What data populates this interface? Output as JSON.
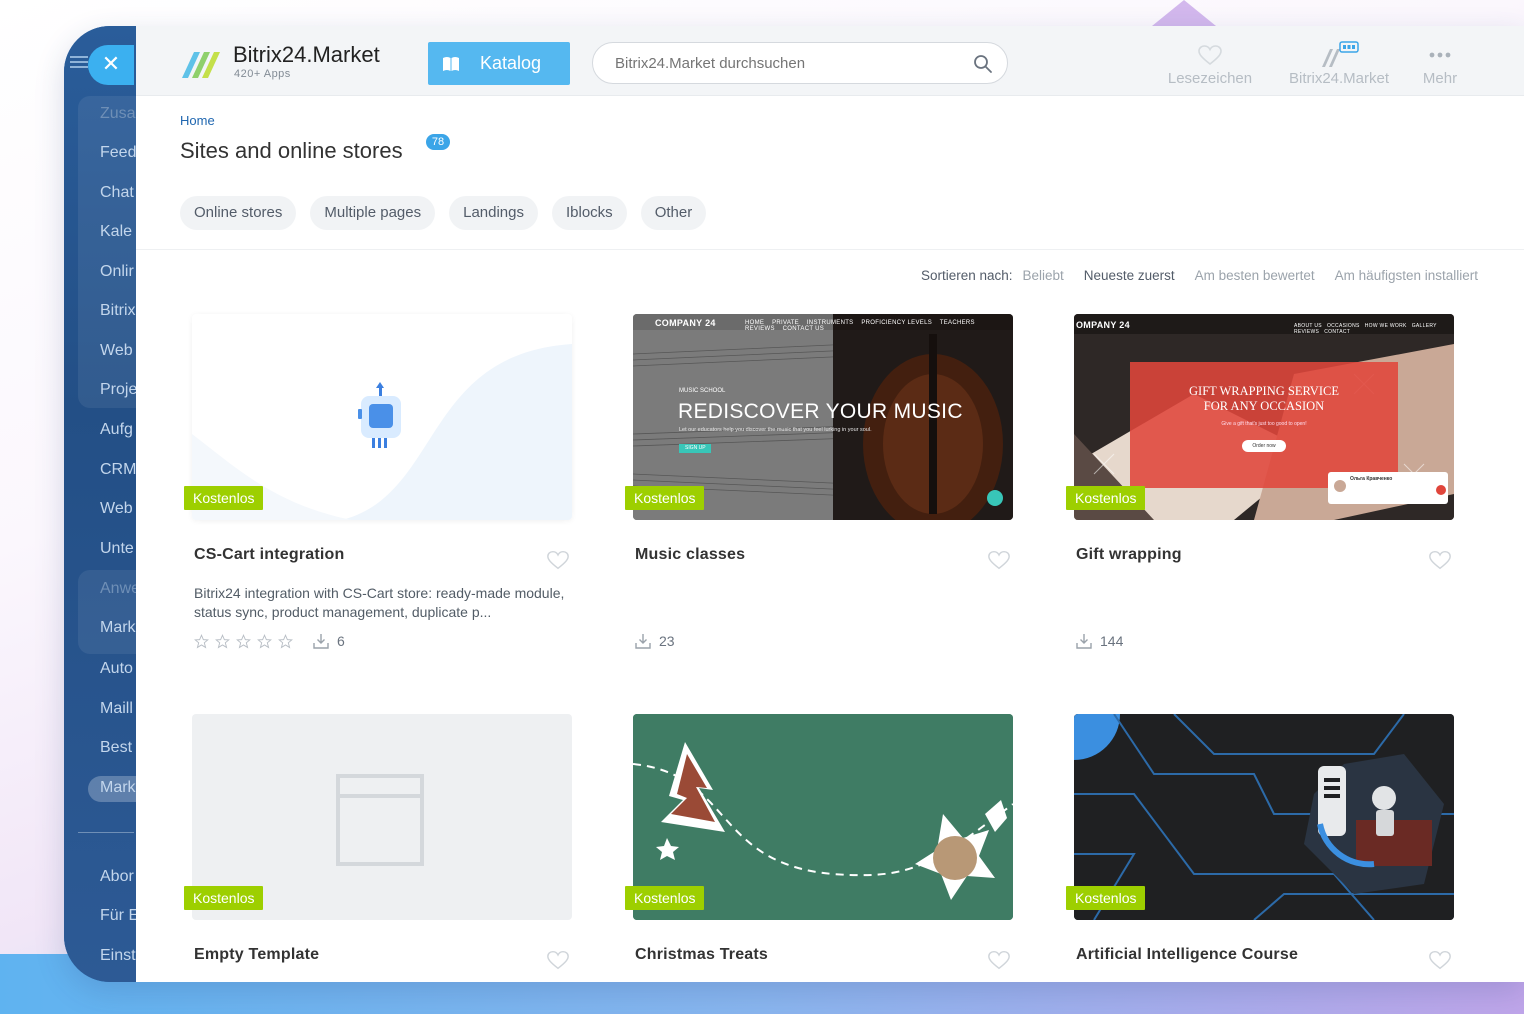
{
  "sidebar": {
    "items": [
      "Zusa",
      "Feed",
      "Chat",
      "Kale",
      "Onlir",
      "Bitrix",
      "Web",
      "Proje",
      "Aufg",
      "CRM",
      "Web",
      "Unte",
      "Anwe",
      "Mark",
      "Auto",
      "Maill",
      "Best",
      "Mark",
      "Abor",
      "Für E",
      "Einst"
    ]
  },
  "header": {
    "logo_title": "Bitrix24.Market",
    "logo_subtitle": "420+ Apps",
    "katalog_label": "Katalog",
    "search_placeholder": "Bitrix24.Market durchsuchen",
    "nav": [
      {
        "label": "Lesezeichen",
        "icon": "heart-icon"
      },
      {
        "label": "Bitrix24.Market",
        "icon": "market-icon"
      },
      {
        "label": "Mehr",
        "icon": "more-dots-icon"
      }
    ]
  },
  "breadcrumb": "Home",
  "page_title": "Sites and online stores",
  "count": "78",
  "filters": [
    "Online stores",
    "Multiple pages",
    "Landings",
    "Iblocks",
    "Other"
  ],
  "sort": {
    "label": "Sortieren nach:",
    "options": [
      "Beliebt",
      "Neueste zuerst",
      "Am besten bewertet",
      "Am häufigsten installiert"
    ]
  },
  "cards": [
    {
      "title": "CS-Cart integration",
      "badge": "Kostenlos",
      "description": "Bitrix24 integration with CS-Cart store: ready-made module, status sync, product management, duplicate p...",
      "rating": 0,
      "installs": "6"
    },
    {
      "title": "Music classes",
      "badge": "Kostenlos",
      "installs": "23",
      "thumb": {
        "brand": "COMPANY 24",
        "nav": [
          "HOME",
          "PRIVATE",
          "INSTRUMENTS",
          "PROFICIENCY LEVELS",
          "TEACHERS",
          "REVIEWS",
          "CONTACT US"
        ],
        "kicker": "MUSIC SCHOOL",
        "headline": "REDISCOVER YOUR MUSIC",
        "sub": "Let our educators help you discover the music that you feel lurking in your soul.",
        "cta": "SIGN UP"
      }
    },
    {
      "title": "Gift wrapping",
      "badge": "Kostenlos",
      "installs": "144",
      "thumb": {
        "brand": "OMPANY 24",
        "nav": [
          "ABOUT US",
          "OCCASIONS",
          "HOW WE WORK",
          "GALLERY",
          "REVIEWS",
          "CONTACT"
        ],
        "headline1": "GIFT WRAPPING SERVICE",
        "headline2": "FOR ANY OCCASION",
        "sub": "Give a gift that's just too good to open!",
        "cta": "Order now",
        "review_name": "Ольга Кравченко"
      }
    },
    {
      "title": "Empty Template",
      "badge": "Kostenlos"
    },
    {
      "title": "Christmas Treats",
      "badge": "Kostenlos"
    },
    {
      "title": "Artificial Intelligence Course",
      "badge": "Kostenlos"
    }
  ]
}
